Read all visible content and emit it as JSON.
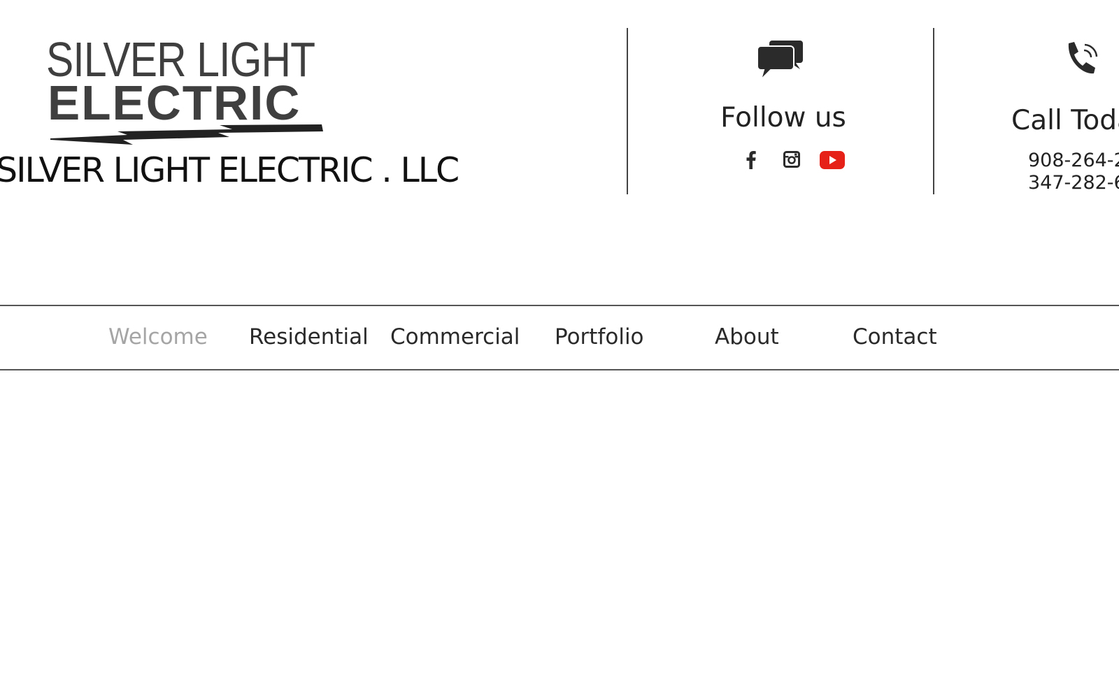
{
  "logo": {
    "line1": "SILVER LIGHT",
    "line2": "ELECTRIC"
  },
  "company_name": "SILVER LIGHT ELECTRIC . LLC",
  "follow": {
    "icon": "chat-bubbles-icon",
    "title": "Follow us",
    "social": [
      {
        "name": "facebook-icon"
      },
      {
        "name": "instagram-icon"
      },
      {
        "name": "youtube-icon",
        "color": "#e62117"
      }
    ]
  },
  "call": {
    "icon": "phone-icon",
    "title": "Call Today",
    "numbers": [
      "908-264-2",
      "347-282-6"
    ]
  },
  "nav": {
    "items": [
      {
        "label": "Welcome",
        "active": true
      },
      {
        "label": "Residential"
      },
      {
        "label": "Commercial"
      },
      {
        "label": "Portfolio"
      },
      {
        "label": "About"
      },
      {
        "label": "Contact"
      }
    ],
    "active_color": "#a5a5a5"
  }
}
